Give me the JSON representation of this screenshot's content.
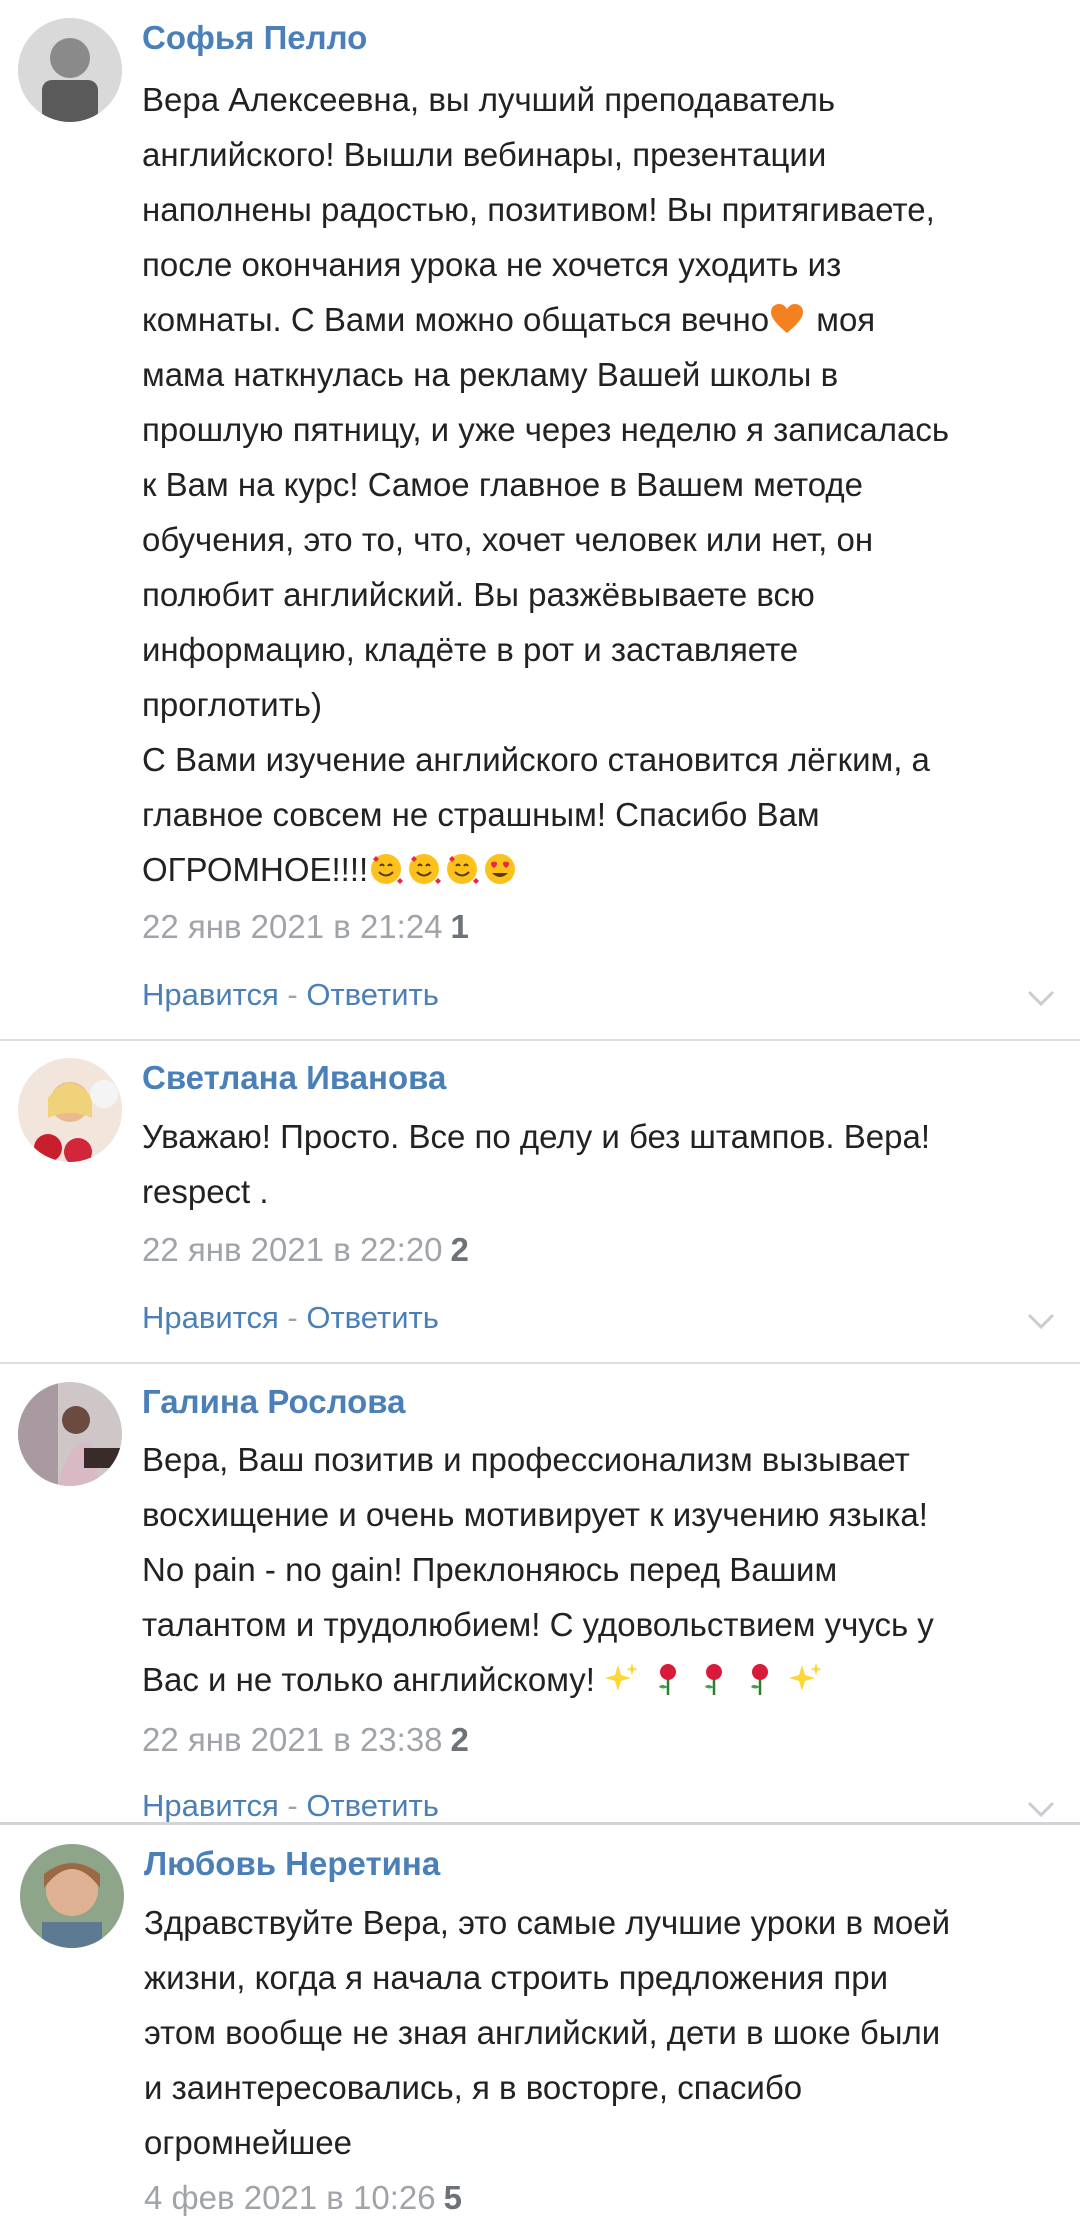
{
  "comments": [
    {
      "author": "Софья Пелло",
      "text": "Вера Алексеевна, вы лучший преподаватель\nанглийского! Вышли вебинары, презентации\nнаполнены радостью, позитивом! Вы притягиваете,\nпосле окончания урока не хочется уходить из\nкомнаты. С Вами можно общаться вечно",
      "text_tail": " моя\nмама наткнулась на рекламу Вашей школы в\nпрошлую пятницу, и уже через неделю я записалась\nк Вам на курс! Самое главное в Вашем методе\nобучения, это то, что, хочет человек или нет, он\nполюбит английский. Вы разжёвываете всю\nинформацию, кладёте в рот и заставляете\nпроглотить)\nС Вами изучение английского становится лёгким, а\nглавное совсем не страшным! Спасибо Вам\nОГРОМНОЕ!!!!",
      "date": "22 янв 2021 в 21:24",
      "likes": "1",
      "like_label": "Нравится",
      "separator": " - ",
      "reply_label": "Ответить"
    },
    {
      "author": "Светлана Иванова",
      "text": "Уважаю! Просто. Все по делу и без штампов. Вера!\nrespect .",
      "date": "22 янв 2021 в 22:20",
      "likes": "2",
      "like_label": "Нравится",
      "separator": " - ",
      "reply_label": "Ответить"
    },
    {
      "author": "Галина Рослова",
      "text": "Вера, Ваш позитив и профессионализм вызывает\nвосхищение и очень мотивирует к изучению языка!\nNo pain - no gain! Преклоняюсь перед Вашим\nталантом и трудолюбием! С удовольствием учусь у\nВас и не только английскому! ",
      "date": "22 янв 2021 в 23:38",
      "likes": "2",
      "like_label": "Нравится",
      "separator": " - ",
      "reply_label": "Ответить"
    },
    {
      "author": "Любовь Неретина",
      "text": "Здравствуйте Вера, это самые лучшие уроки в моей\nжизни, когда я начала строить предложения при\nэтом вообще не зная английский, дети в шоке были\nи заинтересовались, я в восторге, спасибо\nогромнейшее",
      "date": "4 фев 2021 в 10:26",
      "likes": "5"
    }
  ],
  "icons": {
    "orange_heart": "orange-heart-icon",
    "smiling_hearts": "smiling-face-with-hearts-icon",
    "heart_eyes": "heart-eyes-icon",
    "sparkles": "sparkles-icon",
    "rose": "rose-icon",
    "chevron": "chevron-down-icon"
  },
  "colors": {
    "author": "#4a7fb8",
    "link": "#4a7fb8",
    "meta": "#a0a4a9",
    "text": "#222222",
    "divider": "#dcdee2"
  }
}
